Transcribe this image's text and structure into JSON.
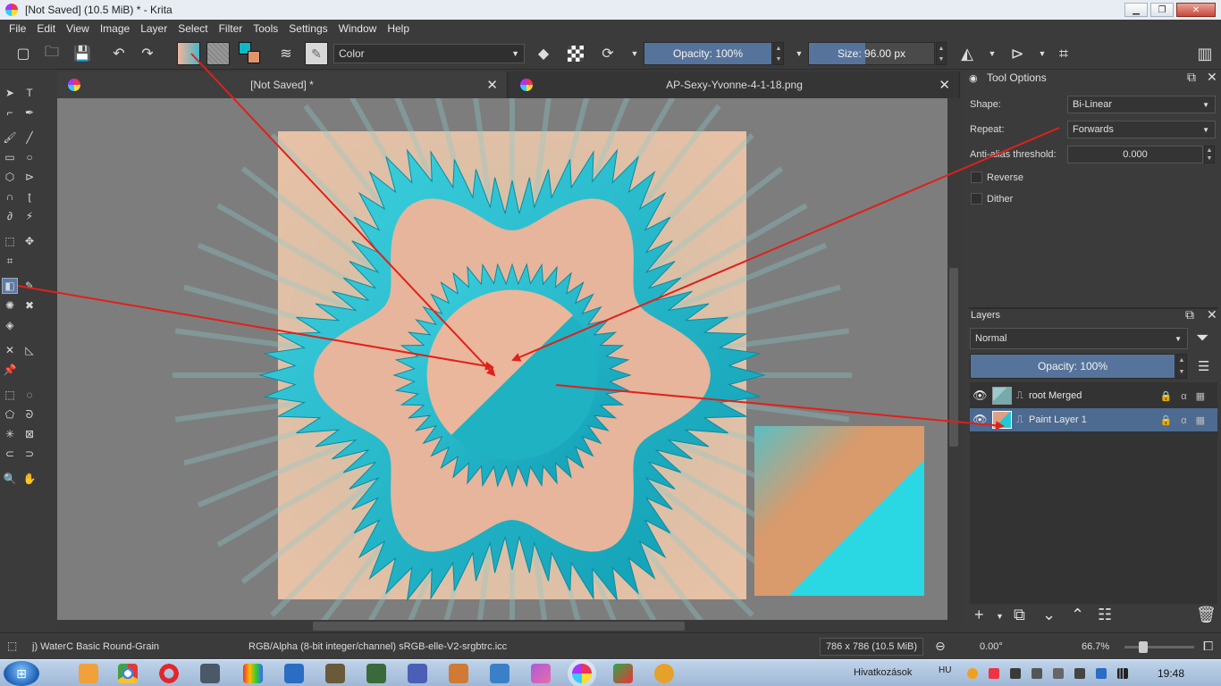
{
  "window": {
    "title": "[Not Saved]  (10.5 MiB)  * - Krita",
    "controls": [
      "minimize",
      "maximize",
      "close"
    ]
  },
  "menu": [
    "File",
    "Edit",
    "View",
    "Image",
    "Layer",
    "Select",
    "Filter",
    "Tools",
    "Settings",
    "Window",
    "Help"
  ],
  "toolbar": {
    "blend_mode": "Color",
    "opacity": "Opacity: 100%",
    "size": "Size: 96.00 px"
  },
  "tabs": [
    {
      "label": "[Not Saved]  *"
    },
    {
      "label": "AP-Sexy-Yvonne-4-1-18.png"
    }
  ],
  "tool_options": {
    "title": "Tool Options",
    "shape_label": "Shape:",
    "shape_value": "Bi-Linear",
    "repeat_label": "Repeat:",
    "repeat_value": "Forwards",
    "antialias_label": "Anti-alias threshold:",
    "antialias_value": "0.000",
    "reverse_label": "Reverse",
    "dither_label": "Dither"
  },
  "layers": {
    "title": "Layers",
    "blend_mode": "Normal",
    "opacity": "Opacity:  100%",
    "items": [
      {
        "name": "root Merged",
        "selected": false
      },
      {
        "name": "Paint Layer 1",
        "selected": true
      }
    ]
  },
  "status": {
    "brush": "j) WaterC Basic Round-Grain",
    "color_space": "RGB/Alpha (8-bit integer/channel)  sRGB-elle-V2-srgbtrc.icc",
    "image_size": "786 x 786 (10.5 MiB)",
    "rotation": "0.00°",
    "zoom": "66.7%"
  },
  "taskbar": {
    "links_label": "Hivatkozások",
    "language": "HU",
    "clock": "19:48"
  },
  "colors": {
    "peach": "#f2b89c",
    "teal": "#1fb5c9",
    "cyan": "#2ad8e4",
    "orange": "#d99a6c",
    "selection": "#4d6a90",
    "arrow": "#e0201a"
  }
}
